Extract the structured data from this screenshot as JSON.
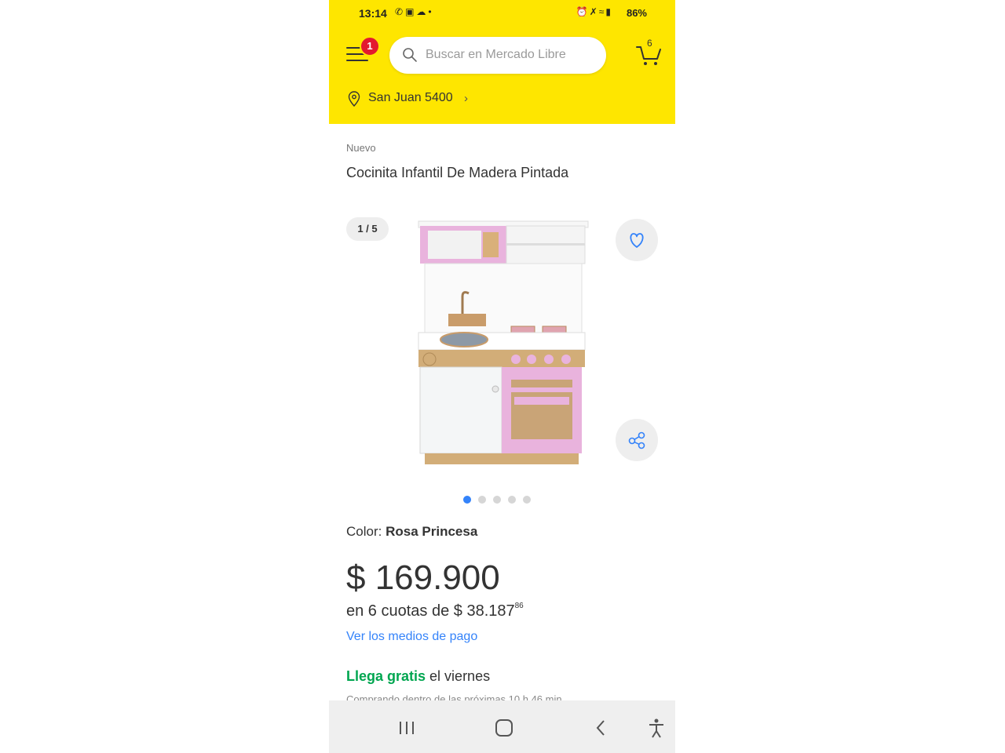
{
  "status_bar": {
    "time": "13:14",
    "left_icons": [
      "whatsapp-icon",
      "facebook-icon",
      "cloud-icon",
      "dot"
    ],
    "battery": "86%"
  },
  "header": {
    "background": "#fee600",
    "menu_badge": "1",
    "search_placeholder": "Buscar en Mercado Libre",
    "cart_count": "6",
    "location": "San Juan 5400"
  },
  "product": {
    "condition": "Nuevo",
    "title": "Cocinita Infantil De Madera Pintada",
    "gallery_counter": "1 / 5",
    "gallery_total": 5,
    "gallery_active": 1,
    "color_label": "Color:",
    "color_value": "Rosa Princesa",
    "price": "$ 169.900",
    "installments_prefix": "en 6 cuotas de $ 38.187",
    "installments_cents": "86",
    "payment_link": "Ver los medios de pago",
    "shipping_highlight": "Llega gratis",
    "shipping_rest": "el viernes",
    "shipping_sub": "Comprando dentro de las próximas 10 h 46 min"
  },
  "colors": {
    "accent_blue": "#3483fa",
    "shipping_green": "#00a650",
    "badge_red": "#e3192f",
    "product_pink": "#e9b3dd"
  },
  "navbar": {
    "buttons": [
      "recent-apps-icon",
      "home-icon",
      "back-icon",
      "accessibility-icon"
    ]
  }
}
